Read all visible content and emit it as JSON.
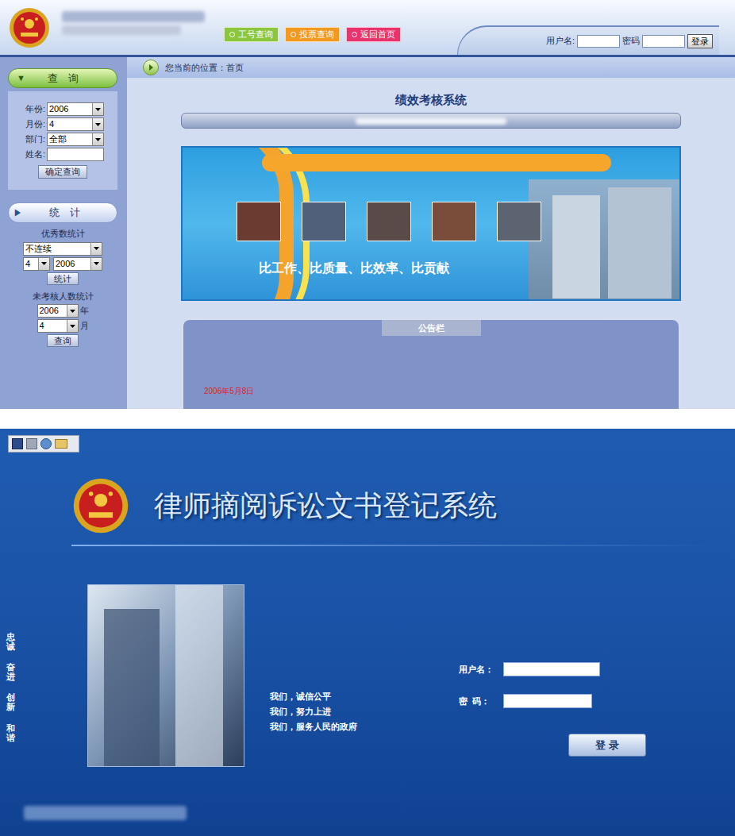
{
  "assessment": {
    "nav_buttons": [
      {
        "label": "工号查询",
        "color": "#8cc63f"
      },
      {
        "label": "投票查询",
        "color": "#f29a1f"
      },
      {
        "label": "返回首页",
        "color": "#e8336d"
      }
    ],
    "login": {
      "username_label": "用户名:",
      "password_label": "密码",
      "submit": "登录"
    },
    "query": {
      "toggle": "▼",
      "title": "查　询",
      "fields": [
        {
          "label": "年份:",
          "value": "2006",
          "kind": "select"
        },
        {
          "label": "月份:",
          "value": "4",
          "kind": "select"
        },
        {
          "label": "部门:",
          "value": "全部",
          "kind": "select"
        },
        {
          "label": "姓名:",
          "value": "",
          "kind": "text"
        }
      ],
      "submit": "确定查询"
    },
    "stats": {
      "toggle": "▶",
      "title": "统　计",
      "excellent": {
        "label": "优秀数统计",
        "mode": "不连续",
        "month": "4",
        "year": "2006",
        "submit": "统计"
      },
      "unassessed": {
        "label": "未考核人数统计",
        "year": "2006",
        "year_unit": "年",
        "month": "4",
        "month_unit": "月",
        "submit": "查询"
      }
    },
    "breadcrumb": "您当前的位置：首页",
    "title": "绩效考核系统",
    "banner_slogan": "比工作、比质量、比效率、比贡献",
    "notice": {
      "title": "公告栏",
      "date": "2006年5月8日"
    }
  },
  "lawyer_login": {
    "title": "律师摘阅诉讼文书登记系统",
    "side_words": [
      "忠诚",
      "奋进",
      "创新",
      "和谐"
    ],
    "mottos": [
      "我们，诚信公平",
      "我们，努力上进",
      "我们，服务人民的政府"
    ],
    "username_label": "用户名：",
    "password_label": "密  码：",
    "submit": "登 录"
  }
}
